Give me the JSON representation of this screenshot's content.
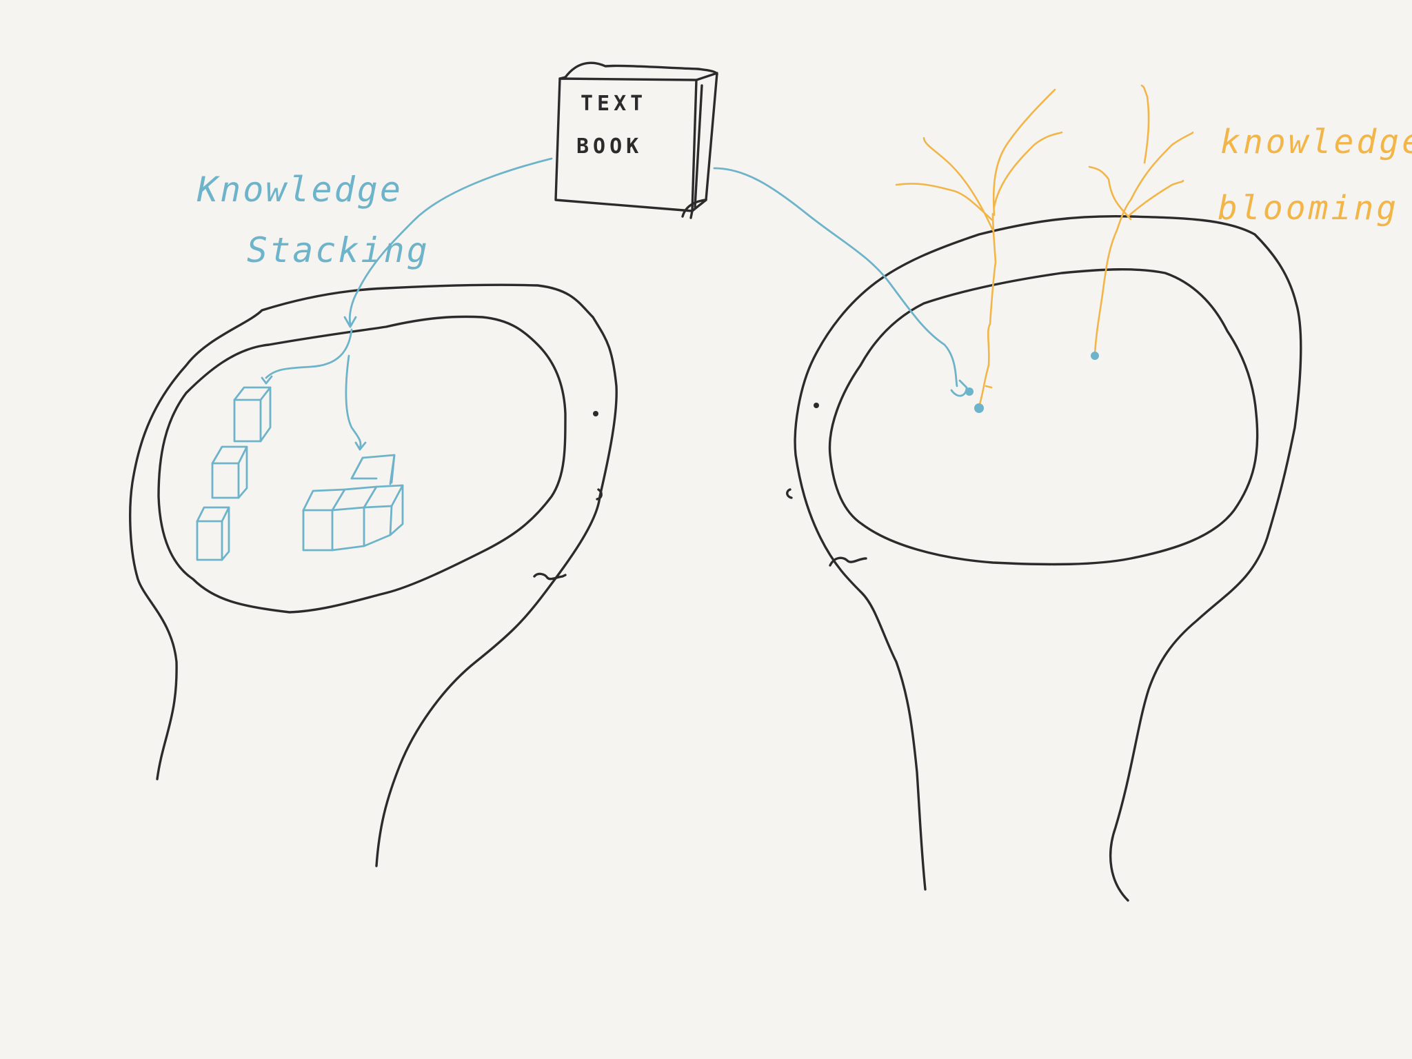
{
  "textbook": {
    "line1": "TEXT",
    "line2": "BOOK"
  },
  "left_label": {
    "line1": "Knowledge",
    "line2": "Stacking"
  },
  "right_label": {
    "line1": "knowledge",
    "line2": "blooming"
  },
  "colors": {
    "background": "#f5f4f0",
    "ink": "#2b2b2b",
    "stacking": "#6db3c9",
    "blooming": "#f2b548"
  },
  "icons": {
    "book": "book-icon",
    "blocks": "cube-blocks-icon",
    "branches": "tree-branches-icon"
  }
}
